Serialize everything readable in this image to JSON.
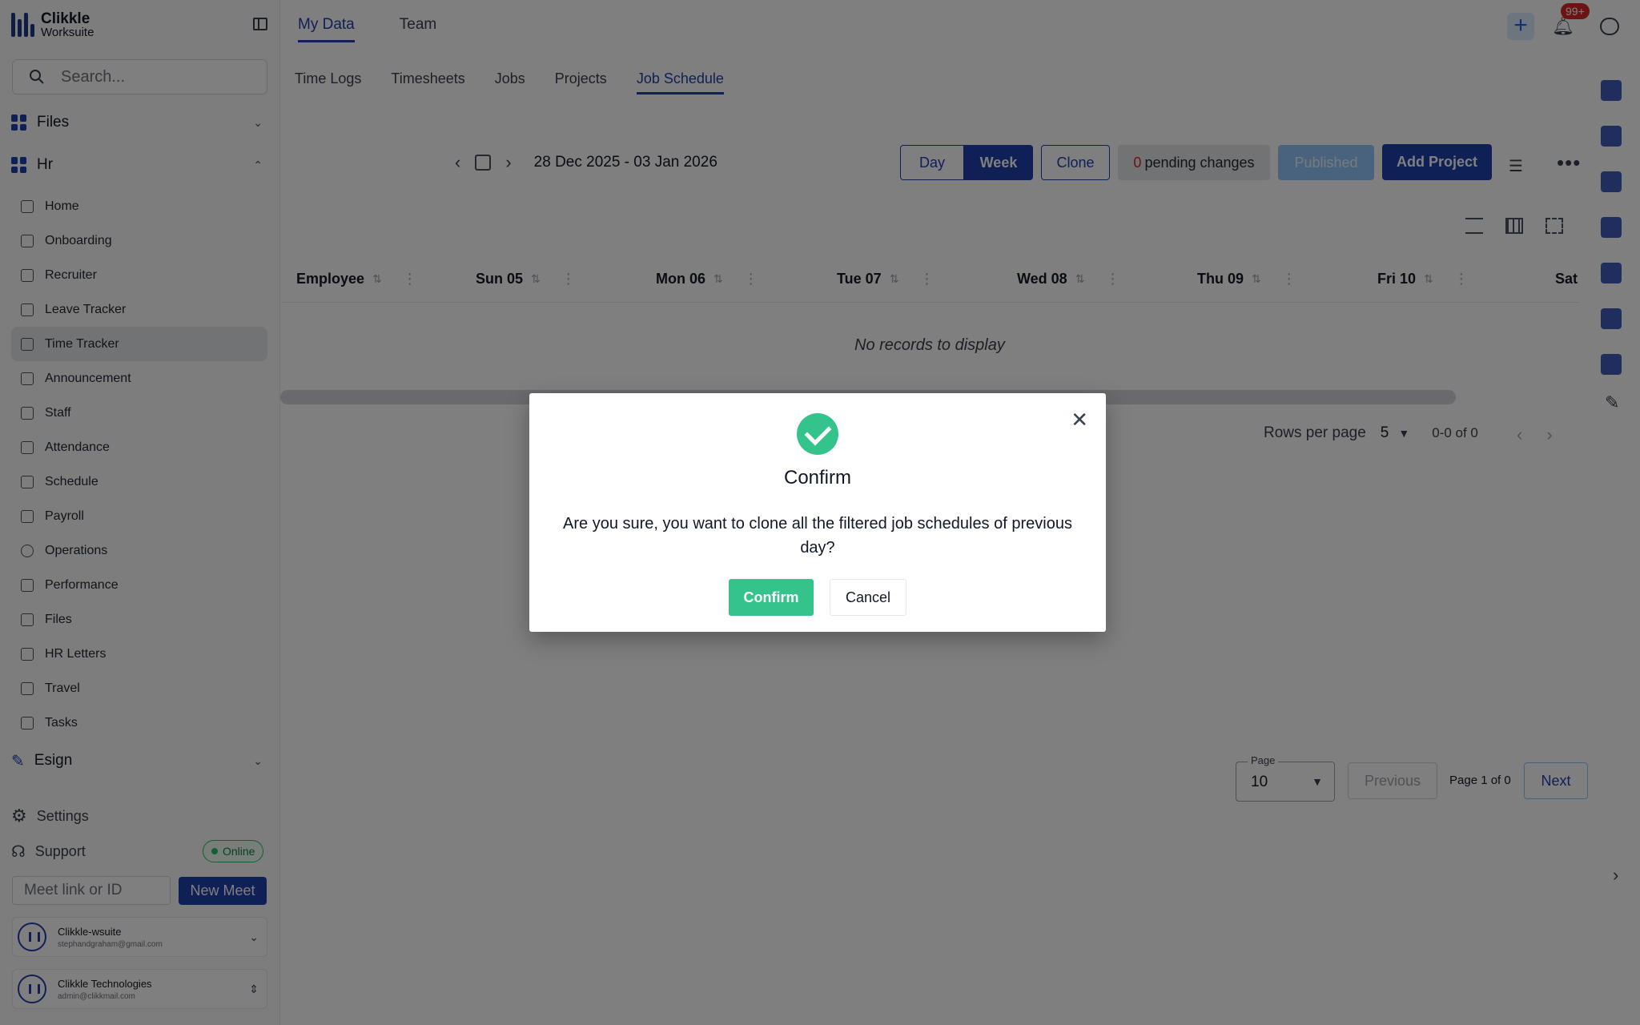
{
  "app": {
    "brand_line1": "Clikkle",
    "brand_line2": "Worksuite"
  },
  "sidebar": {
    "search_placeholder": "Search...",
    "files_label": "Files",
    "hr_label": "Hr",
    "items": [
      {
        "label": "Home",
        "icon": "home-icon"
      },
      {
        "label": "Onboarding",
        "icon": "onboarding-icon"
      },
      {
        "label": "Recruiter",
        "icon": "briefcase-icon"
      },
      {
        "label": "Leave Tracker",
        "icon": "beach-icon"
      },
      {
        "label": "Time Tracker",
        "icon": "alarm-icon"
      },
      {
        "label": "Announcement",
        "icon": "megaphone-icon"
      },
      {
        "label": "Staff",
        "icon": "people-icon"
      },
      {
        "label": "Attendance",
        "icon": "id-card-icon"
      },
      {
        "label": "Schedule",
        "icon": "calendar-icon"
      },
      {
        "label": "Payroll",
        "icon": "payroll-icon"
      },
      {
        "label": "Operations",
        "icon": "circle-icon"
      },
      {
        "label": "Performance",
        "icon": "bar-chart-icon"
      },
      {
        "label": "Files",
        "icon": "file-icon"
      },
      {
        "label": "HR Letters",
        "icon": "letter-icon"
      },
      {
        "label": "Travel",
        "icon": "plane-icon"
      },
      {
        "label": "Tasks",
        "icon": "task-icon"
      }
    ],
    "esign_label": "Esign",
    "settings_label": "Settings",
    "support_label": "Support",
    "online_label": "Online",
    "meet_placeholder": "Meet link or ID",
    "new_meet_label": "New Meet",
    "accounts": [
      {
        "name": "Clikkle-wsuite",
        "email": "stephandgraham@gmail.com"
      },
      {
        "name": "Clikkle Technologies",
        "email": "admin@clikkmail.com"
      }
    ]
  },
  "header": {
    "tabs": [
      "My Data",
      "Team"
    ],
    "notif_count": "99+"
  },
  "subtabs": [
    "Time Logs",
    "Timesheets",
    "Jobs",
    "Projects",
    "Job Schedule"
  ],
  "toolbar": {
    "date_range": "28 Dec 2025 - 03 Jan 2026",
    "day": "Day",
    "week": "Week",
    "clone": "Clone",
    "pending_count": "0",
    "pending_text": "pending changes",
    "published": "Published",
    "add_project": "Add Project"
  },
  "grid": {
    "columns": [
      "Employee",
      "Sun 05",
      "Mon 06",
      "Tue 07",
      "Wed 08",
      "Thu 09",
      "Fri 10",
      "Sat"
    ],
    "empty_text": "No records to display",
    "rows_per_page_label": "Rows per page",
    "rows_per_page_value": "5",
    "range_text": "0-0 of 0"
  },
  "pagination": {
    "page_label": "Page",
    "page_size": "10",
    "previous": "Previous",
    "info": "Page 1 of 0",
    "next": "Next"
  },
  "modal": {
    "title": "Confirm",
    "message": "Are you sure, you want to clone all the filtered job schedules of previous day?",
    "confirm": "Confirm",
    "cancel": "Cancel",
    "close_glyph": "✕"
  },
  "colors": {
    "accent": "#1e40af",
    "success": "#34c48b",
    "danger": "#dc2626"
  }
}
